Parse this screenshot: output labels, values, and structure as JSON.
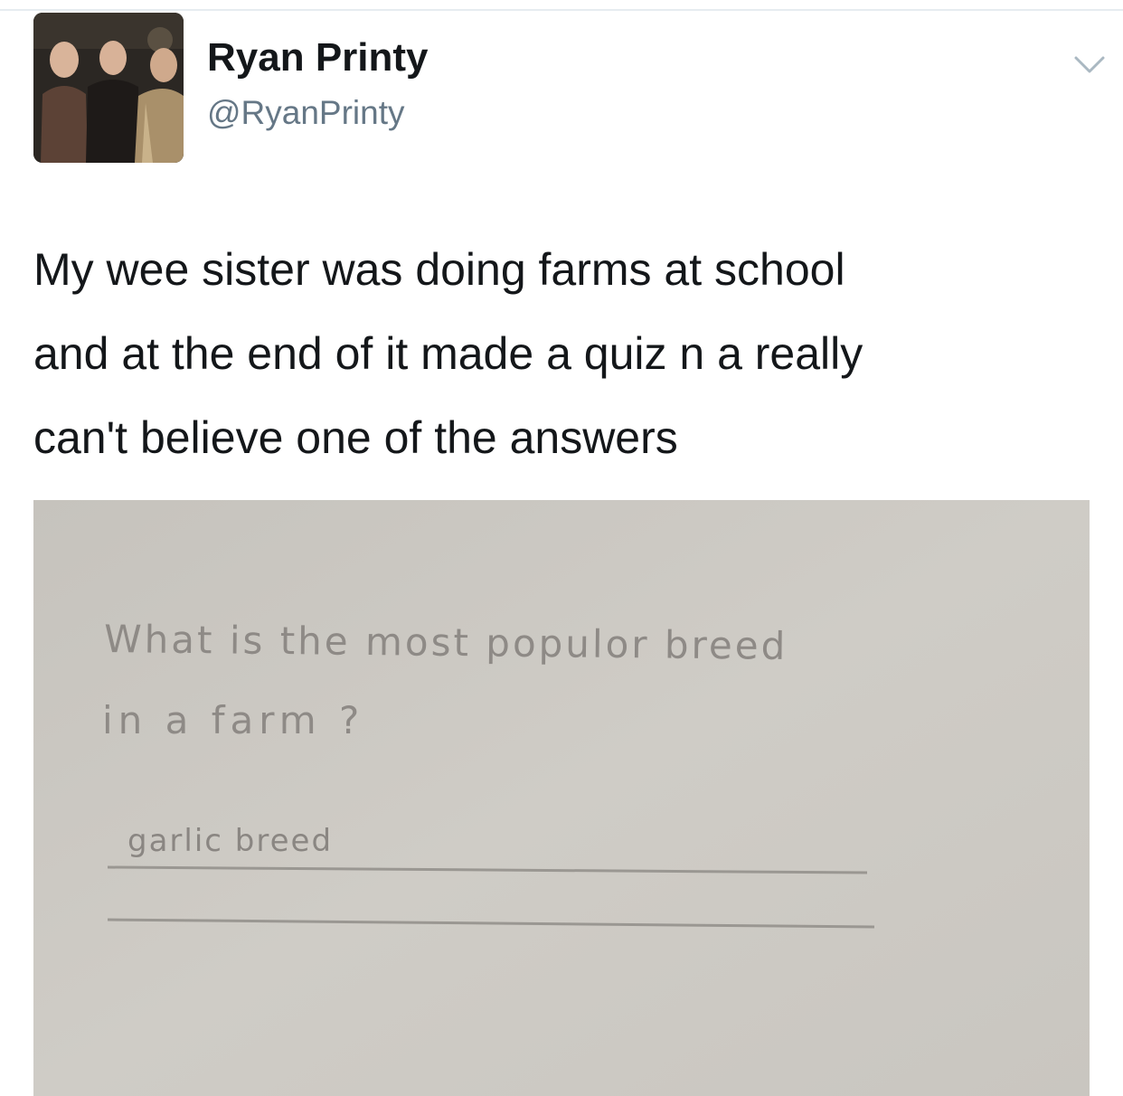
{
  "tweet": {
    "author": {
      "display_name": "Ryan Printy",
      "handle": "@RyanPrinty"
    },
    "menu_icon": "chevron-down-icon",
    "text_lines": [
      "My wee sister was doing farms at school",
      "and at the end of it made a quiz n a really",
      "can't believe one of the answers"
    ],
    "photo": {
      "handwritten_question_line1": "What is the most populor breed",
      "handwritten_question_line2": "in a farm ?",
      "handwritten_answer": "garlic breed"
    }
  },
  "colors": {
    "text_primary": "#14171a",
    "text_secondary": "#657786",
    "paper": "#cbc8c2",
    "pencil": "#8e8a86"
  }
}
